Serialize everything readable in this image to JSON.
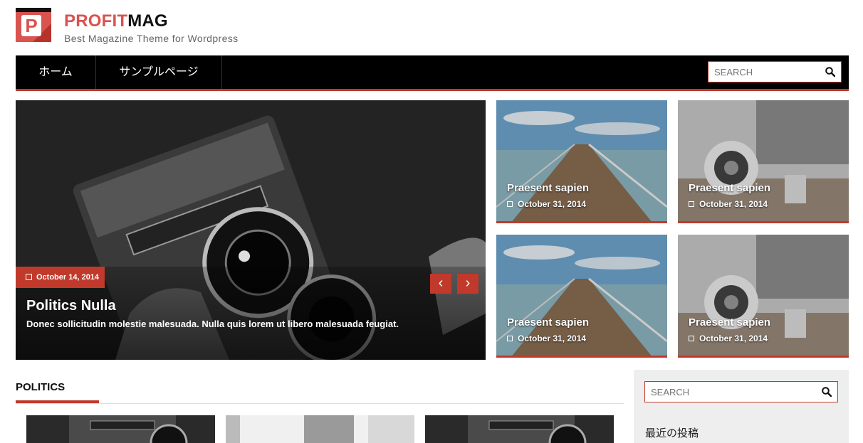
{
  "header": {
    "logo_letter": "P",
    "title_part1": "PROFIT",
    "title_part2": "MAG",
    "tagline": "Best Magazine Theme for Wordpress",
    "accent_color": "#d9534f"
  },
  "nav": {
    "items": [
      {
        "label": "ホーム"
      },
      {
        "label": "サンプルページ"
      }
    ],
    "search_placeholder": "SEARCH",
    "search_icon": "search-icon"
  },
  "slider": {
    "date": "October 14, 2014",
    "title": "Politics Nulla",
    "excerpt": "Donec sollicitudin molestie malesuada. Nulla quis lorem ut libero malesuada feugiat.",
    "prev_arrow": "‹",
    "next_arrow": "›"
  },
  "featured": [
    {
      "title": "Praesent sapien",
      "date": "October 31, 2014",
      "image": "pier"
    },
    {
      "title": "Praesent sapien",
      "date": "October 31, 2014",
      "image": "desk"
    },
    {
      "title": "Praesent sapien",
      "date": "October 31, 2014",
      "image": "pier"
    },
    {
      "title": "Praesent sapien",
      "date": "October 31, 2014",
      "image": "desk"
    }
  ],
  "politics": {
    "heading": "POLITICS"
  },
  "sidebar": {
    "search_placeholder": "SEARCH",
    "recent_heading": "最近の投稿"
  },
  "colors": {
    "brand_red": "#c0392b",
    "nav_bg": "#000000",
    "sidebar_bg": "#eeeeee"
  }
}
